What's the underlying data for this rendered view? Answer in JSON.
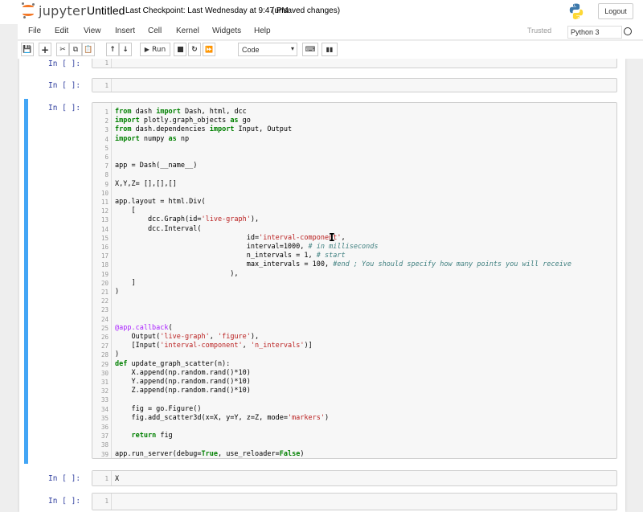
{
  "header": {
    "logo_text": "jupyter",
    "title": "Untitled",
    "checkpoint": "Last Checkpoint: Last Wednesday at 9:47 PM",
    "autosave": "(unsaved changes)",
    "logout": "Logout"
  },
  "menubar": {
    "items": [
      "File",
      "Edit",
      "View",
      "Insert",
      "Cell",
      "Kernel",
      "Widgets",
      "Help"
    ],
    "trusted": "Trusted",
    "kernel": "Python 3"
  },
  "toolbar": {
    "run_label": "Run",
    "cell_type": "Code"
  },
  "cells": [
    {
      "prompt": "In [ ]:",
      "lines": [
        {
          "n": "1",
          "t": ""
        }
      ]
    },
    {
      "prompt": "In [ ]:",
      "lines": [
        {
          "n": "1",
          "t": ""
        }
      ]
    },
    {
      "prompt": "In [ ]:",
      "lines": [
        {
          "n": "1",
          "t": "from dash import Dash, html, dcc"
        },
        {
          "n": "2",
          "t": "import plotly.graph_objects as go"
        },
        {
          "n": "3",
          "t": "from dash.dependencies import Input, Output"
        },
        {
          "n": "4",
          "t": "import numpy as np"
        },
        {
          "n": "5",
          "t": ""
        },
        {
          "n": "6",
          "t": ""
        },
        {
          "n": "7",
          "t": "app = Dash(__name__)"
        },
        {
          "n": "8",
          "t": ""
        },
        {
          "n": "9",
          "t": "X,Y,Z= [],[],[]"
        },
        {
          "n": "10",
          "t": ""
        },
        {
          "n": "11",
          "t": "app.layout = html.Div("
        },
        {
          "n": "12",
          "t": "    ["
        },
        {
          "n": "13",
          "t": "        dcc.Graph(id='live-graph'),"
        },
        {
          "n": "14",
          "t": "        dcc.Interval("
        },
        {
          "n": "15",
          "t": "                                id='interval-component',"
        },
        {
          "n": "16",
          "t": "                                interval=1000, # in milliseconds"
        },
        {
          "n": "17",
          "t": "                                n_intervals = 1, # start"
        },
        {
          "n": "18",
          "t": "                                max_intervals = 100, #end ; You should specify how many points you will receive"
        },
        {
          "n": "19",
          "t": "                            ),"
        },
        {
          "n": "20",
          "t": "    ]"
        },
        {
          "n": "21",
          "t": ")"
        },
        {
          "n": "22",
          "t": ""
        },
        {
          "n": "23",
          "t": ""
        },
        {
          "n": "24",
          "t": ""
        },
        {
          "n": "25",
          "t": "@app.callback("
        },
        {
          "n": "26",
          "t": "    Output('live-graph', 'figure'),"
        },
        {
          "n": "27",
          "t": "    [Input('interval-component', 'n_intervals')]"
        },
        {
          "n": "28",
          "t": ")"
        },
        {
          "n": "29",
          "t": "def update_graph_scatter(n):"
        },
        {
          "n": "30",
          "t": "    X.append(np.random.rand()*10)"
        },
        {
          "n": "31",
          "t": "    Y.append(np.random.rand()*10)"
        },
        {
          "n": "32",
          "t": "    Z.append(np.random.rand()*10)"
        },
        {
          "n": "33",
          "t": ""
        },
        {
          "n": "34",
          "t": "    fig = go.Figure()"
        },
        {
          "n": "35",
          "t": "    fig.add_scatter3d(x=X, y=Y, z=Z, mode='markers')"
        },
        {
          "n": "36",
          "t": ""
        },
        {
          "n": "37",
          "t": "    return fig"
        },
        {
          "n": "38",
          "t": ""
        },
        {
          "n": "39",
          "t": "app.run_server(debug=True, use_reloader=False)"
        }
      ]
    },
    {
      "prompt": "In [ ]:",
      "lines": [
        {
          "n": "1",
          "t": "X"
        }
      ]
    },
    {
      "prompt": "In [ ]:",
      "lines": [
        {
          "n": "1",
          "t": ""
        }
      ]
    }
  ]
}
